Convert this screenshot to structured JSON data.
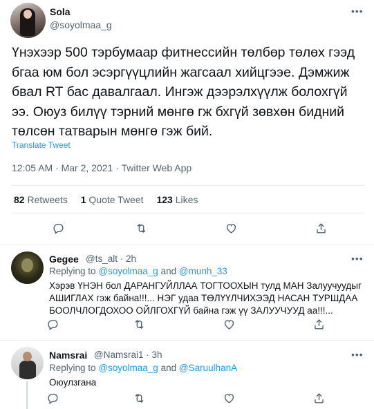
{
  "main_tweet": {
    "author_name": "Sola",
    "author_handle": "@soyolmaa_g",
    "more_icon": "more-horizontal-icon",
    "text": "Үнэхээр 500 тэрбумаар фитнессийн төлбөр төлөх гээд бгаа юм бол эсэргүүцлийн жагсаал хийцгээе. Дэмжиж бвал RT бас давалгаал. Ингэж дээрэлхүүлж болохгүй ээ. Оюуз билүү тэрний мөнгө гж бхгүй зөвхөн бидний төлсөн татварын мөнгө гэж бий.",
    "translate_label": "Translate Tweet",
    "time": "12:05 AM",
    "date": "Mar 2, 2021",
    "source": "Twitter Web App",
    "retweets_count": "82",
    "retweets_label": "Retweets",
    "quotes_count": "1",
    "quotes_label": "Quote Tweet",
    "likes_count": "123",
    "likes_label": "Likes"
  },
  "replies": [
    {
      "name": "Gegee",
      "handle": "@ts_alt",
      "age": "2h",
      "replying_label": "Replying to",
      "mention_1": "@soyolmaa_g",
      "and_label": "and",
      "mention_2": "@munh_33",
      "text": "Хэрэв ҮНЭН бол ДАРАНГУЙЛЛАА ТОГТООХЫН тулд МАН Залуучуудыг\nАШИГЛАХ гэж байна!!!... НЭГ удаа ТӨЛҮҮЛЧИХЭЭД НАСАН ТУРШДАА\nБООЛЧЛОГДОХОО ОЙЛГОХГҮЙ байна гэж үү ЗАЛУУЧУУД аа!!!..."
    },
    {
      "name": "Namsrai",
      "handle": "@Namsrai1",
      "age": "3h",
      "replying_label": "Replying to",
      "mention_1": "@soyolmaa_g",
      "and_label": "and",
      "mention_2": "@SaruulhanA",
      "text": "Оюулзгана"
    }
  ],
  "separator": "·",
  "icons": [
    "reply-icon",
    "retweet-icon",
    "like-icon",
    "share-icon"
  ],
  "colors": {
    "link": "#1d9bf0",
    "secondary_text": "#536471",
    "divider": "#eff3f4"
  }
}
